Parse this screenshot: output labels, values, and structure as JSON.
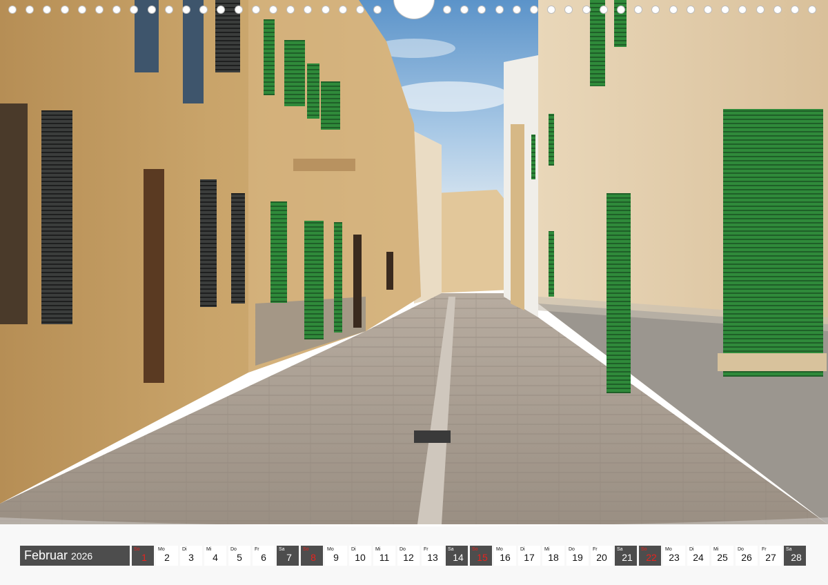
{
  "calendar": {
    "month": "Februar",
    "year": "2026",
    "days": [
      {
        "dow": "So",
        "num": "1",
        "type": "sun"
      },
      {
        "dow": "Mo",
        "num": "2",
        "type": "weekday"
      },
      {
        "dow": "Di",
        "num": "3",
        "type": "weekday"
      },
      {
        "dow": "Mi",
        "num": "4",
        "type": "weekday"
      },
      {
        "dow": "Do",
        "num": "5",
        "type": "weekday"
      },
      {
        "dow": "Fr",
        "num": "6",
        "type": "weekday"
      },
      {
        "dow": "Sa",
        "num": "7",
        "type": "sat"
      },
      {
        "dow": "So",
        "num": "8",
        "type": "sun"
      },
      {
        "dow": "Mo",
        "num": "9",
        "type": "weekday"
      },
      {
        "dow": "Di",
        "num": "10",
        "type": "weekday"
      },
      {
        "dow": "Mi",
        "num": "11",
        "type": "weekday"
      },
      {
        "dow": "Do",
        "num": "12",
        "type": "weekday"
      },
      {
        "dow": "Fr",
        "num": "13",
        "type": "weekday"
      },
      {
        "dow": "Sa",
        "num": "14",
        "type": "sat"
      },
      {
        "dow": "So",
        "num": "15",
        "type": "sun"
      },
      {
        "dow": "Mo",
        "num": "16",
        "type": "weekday"
      },
      {
        "dow": "Di",
        "num": "17",
        "type": "weekday"
      },
      {
        "dow": "Mi",
        "num": "18",
        "type": "weekday"
      },
      {
        "dow": "Do",
        "num": "19",
        "type": "weekday"
      },
      {
        "dow": "Fr",
        "num": "20",
        "type": "weekday"
      },
      {
        "dow": "Sa",
        "num": "21",
        "type": "sat"
      },
      {
        "dow": "So",
        "num": "22",
        "type": "sun"
      },
      {
        "dow": "Mo",
        "num": "23",
        "type": "weekday"
      },
      {
        "dow": "Di",
        "num": "24",
        "type": "weekday"
      },
      {
        "dow": "Mi",
        "num": "25",
        "type": "weekday"
      },
      {
        "dow": "Do",
        "num": "26",
        "type": "weekday"
      },
      {
        "dow": "Fr",
        "num": "27",
        "type": "weekday"
      },
      {
        "dow": "Sa",
        "num": "28",
        "type": "sat"
      }
    ]
  },
  "colors": {
    "sunday": "#e8231e",
    "weekend_box": "#4d4d4d",
    "shutter_green": "#2f8a3a",
    "sandstone": "#c9a46a"
  },
  "icons": {
    "binding": "spiral-binding-hole-icon",
    "hanger": "hanger-notch-icon"
  }
}
